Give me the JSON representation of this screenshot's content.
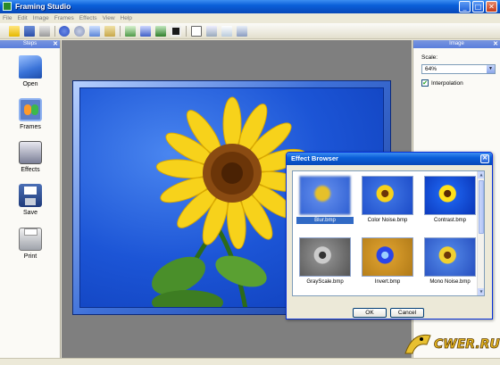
{
  "window": {
    "title": "Framing Studio",
    "minimize": "_",
    "maximize": "□",
    "close": "✕"
  },
  "menu": [
    "File",
    "Edit",
    "Image",
    "Frames",
    "Effects",
    "View",
    "Help"
  ],
  "steps_panel": {
    "title": "Steps",
    "close": "✕",
    "items": [
      {
        "label": "Open",
        "icon": "folder-icon"
      },
      {
        "label": "Frames",
        "icon": "frames-icon"
      },
      {
        "label": "Effects",
        "icon": "effects-icon"
      },
      {
        "label": "Save",
        "icon": "floppy-disk-icon"
      },
      {
        "label": "Print",
        "icon": "printer-icon"
      }
    ]
  },
  "image_panel": {
    "title": "Image",
    "close": "✕",
    "scale_label": "Scale:",
    "scale_value": "64%",
    "interpolation_label": "Interpolation",
    "interpolation_checked": "✔"
  },
  "effect_browser": {
    "title": "Effect Browser",
    "close": "✕",
    "effects": [
      {
        "name": "Blur.bmp",
        "selected": true
      },
      {
        "name": "Color Noise.bmp",
        "selected": false
      },
      {
        "name": "Contrast.bmp",
        "selected": false
      },
      {
        "name": "GrayScale.bmp",
        "selected": false
      },
      {
        "name": "Invert.bmp",
        "selected": false
      },
      {
        "name": "Mono Noise.bmp",
        "selected": false
      }
    ],
    "ok": "OK",
    "cancel": "Cancel"
  },
  "watermark": "CWER.RU",
  "colors": {
    "xp_blue": "#0a5fd9",
    "sky": "#1c55d6",
    "petal": "#f7d21b",
    "selection": "#316ac5"
  }
}
